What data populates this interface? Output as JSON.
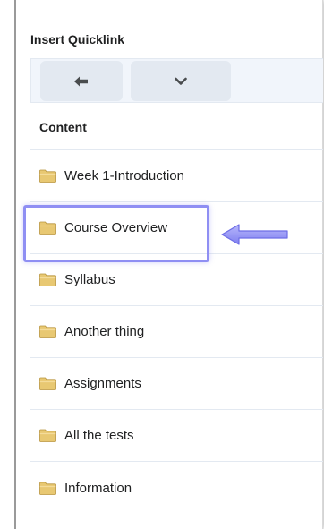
{
  "dialog": {
    "title": "Insert Quicklink"
  },
  "toolbar": {
    "back_icon": "arrow-left-icon",
    "more_icon": "chevron-down-icon"
  },
  "list": {
    "header": "Content",
    "items": [
      {
        "label": "Week 1-Introduction",
        "icon": "folder-icon"
      },
      {
        "label": "Course Overview",
        "icon": "folder-icon",
        "highlighted": true
      },
      {
        "label": "Syllabus",
        "icon": "folder-icon"
      },
      {
        "label": "Another thing",
        "icon": "folder-icon"
      },
      {
        "label": "Assignments",
        "icon": "folder-icon"
      },
      {
        "label": "All the tests",
        "icon": "folder-icon"
      },
      {
        "label": "Information",
        "icon": "folder-icon"
      }
    ]
  },
  "colors": {
    "folder": "#e8c872",
    "highlight": "#8f8ff3",
    "toolbar_bg": "#f1f5fb",
    "button_bg": "#e3e9f1",
    "text": "#202122"
  }
}
